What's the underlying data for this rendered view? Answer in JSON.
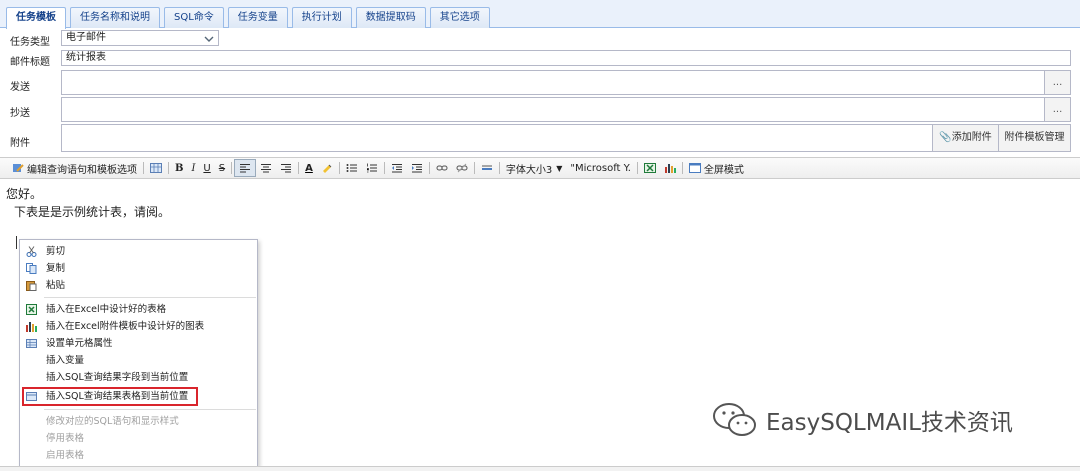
{
  "tabs": [
    "任务模板",
    "任务名称和说明",
    "SQL命令",
    "任务变量",
    "执行计划",
    "数据提取码",
    "其它选项"
  ],
  "form": {
    "task_type_label": "任务类型",
    "task_type_value": "电子邮件",
    "subject_label": "邮件标题",
    "subject_value": "统计报表",
    "to_label": "发送",
    "cc_label": "抄送",
    "attach_label": "附件",
    "dots": "...",
    "add_attachment": "添加附件",
    "attach_template_manage": "附件模板管理"
  },
  "toolbar": {
    "edit_query": "编辑查询语句和模板选项",
    "bold": "B",
    "italic": "I",
    "underline": "U",
    "strike": "S",
    "font_color": "A",
    "font_size": "字体大小3",
    "font_family": "\"Microsoft Y.",
    "fullscreen": "全屏模式"
  },
  "editor": {
    "greeting": "您好。",
    "body": "下表是是示例统计表，请阅。"
  },
  "context_menu": {
    "items": [
      "剪切",
      "复制",
      "粘贴",
      "插入在Excel中设计好的表格",
      "插入在Excel附件模板中设计好的图表",
      "设置单元格属性",
      "插入变量",
      "插入SQL查询结果字段到当前位置",
      "插入SQL查询结果表格到当前位置",
      "修改对应的SQL语句和显示样式",
      "停用表格",
      "启用表格"
    ]
  },
  "watermark": "EasySQLMAIL技术资讯",
  "colors": {
    "tab_text": "#15428b",
    "border": "#99bbe8",
    "highlight": "#d9252c"
  }
}
